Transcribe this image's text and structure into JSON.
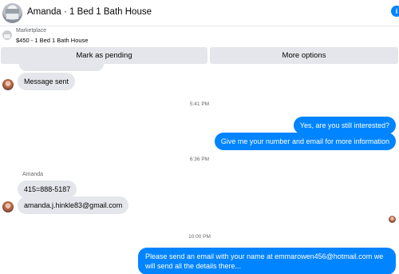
{
  "header": {
    "title": "Amanda · 1 Bed 1 Bath House",
    "info_glyph": "i",
    "avatar_icon": "house-thumbnail-icon"
  },
  "marketplace": {
    "label": "Marketplace",
    "item": "$450 - 1 Bed 1 Bath House"
  },
  "actions": {
    "mark_pending": "Mark as pending",
    "more_options": "More options"
  },
  "messages": {
    "message_sent": "Message sent",
    "ts1": "5:41 PM",
    "out1": "Yes, are you still interested?",
    "out2": "Give me your number and email for more information",
    "ts2": "6:36 PM",
    "sender_name": "Amanda",
    "in_phone": "415=888-5187",
    "in_email": "amanda.j.hinkle83@gmail.com",
    "ts3": "10:00 PM",
    "out3": "Please send an email with your name at emmarowen456@hotmail.com we will send all the details there..."
  },
  "colors": {
    "accent": "#0084ff",
    "incoming_bubble": "#e4e6eb",
    "muted_text": "#65676b"
  }
}
